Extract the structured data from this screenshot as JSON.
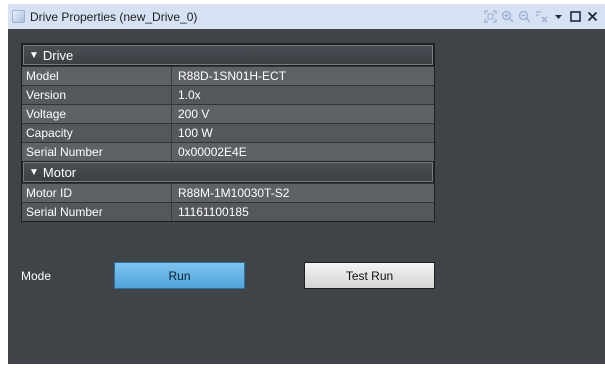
{
  "window": {
    "title": "Drive Properties (new_Drive_0)",
    "toolbar_icons": [
      "fit-view-icon",
      "zoom-in-icon",
      "zoom-out-icon",
      "layout-icon",
      "dropdown-icon",
      "maximize-icon",
      "close-icon"
    ]
  },
  "drive": {
    "header": "Drive",
    "rows": [
      {
        "name": "Model",
        "value": "R88D-1SN01H-ECT"
      },
      {
        "name": "Version",
        "value": "1.0x"
      },
      {
        "name": "Voltage",
        "value": "200 V"
      },
      {
        "name": "Capacity",
        "value": "100 W"
      },
      {
        "name": "Serial Number",
        "value": "0x00002E4E"
      }
    ]
  },
  "motor": {
    "header": "Motor",
    "rows": [
      {
        "name": "Motor ID",
        "value": "R88M-1M10030T-S2"
      },
      {
        "name": "Serial Number",
        "value": "11161100185"
      }
    ]
  },
  "mode": {
    "label": "Mode",
    "run_label": "Run",
    "test_run_label": "Test Run"
  },
  "colors": {
    "panel_bg": "#404347",
    "titlebar_bg": "#d6e2f3",
    "run_button": "#5aaee3",
    "test_button": "#e4e4e4"
  }
}
